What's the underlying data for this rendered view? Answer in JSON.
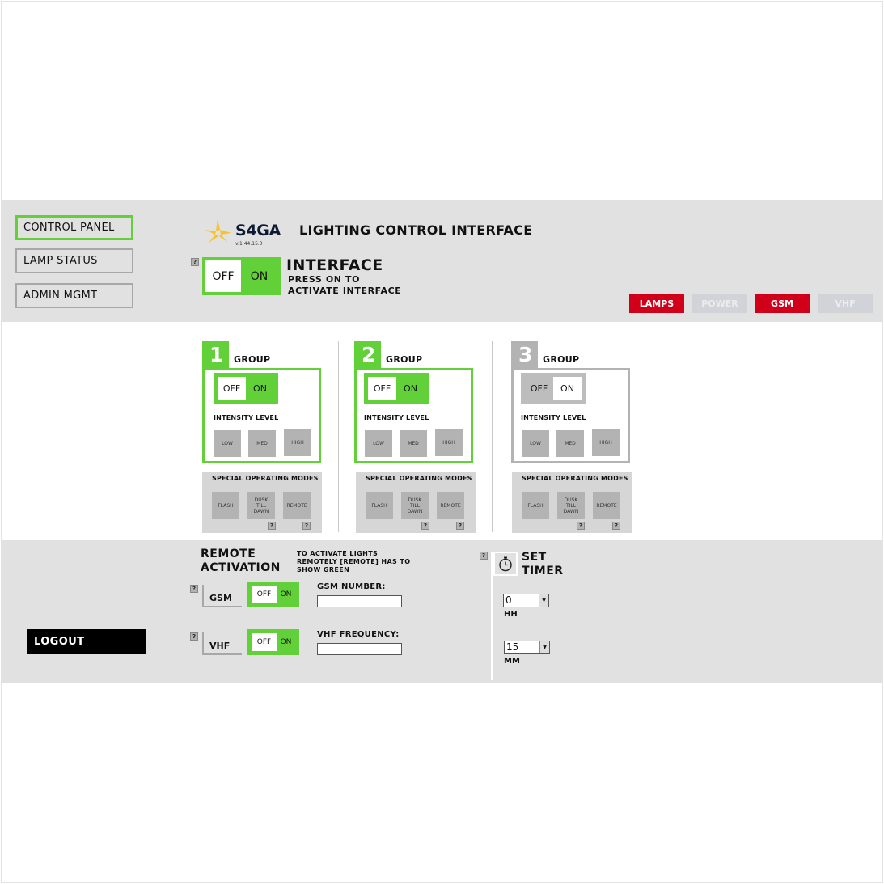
{
  "nav": {
    "items": [
      {
        "label": "CONTROL PANEL",
        "active": true
      },
      {
        "label": "LAMP STATUS",
        "active": false
      },
      {
        "label": "ADMIN MGMT",
        "active": false
      }
    ],
    "logout": "LOGOUT"
  },
  "header": {
    "brand": "S4GA",
    "version": "v.1.44.15.0",
    "title": "LIGHTING CONTROL INTERFACE",
    "interface_title": "INTERFACE",
    "interface_subtitle": "PRESS ON TO ACTIVATE INTERFACE",
    "interface_toggle": {
      "off": "OFF",
      "on": "ON",
      "state": "on"
    },
    "help": "?",
    "status_tags": [
      {
        "label": "LAMPS",
        "state": "alert",
        "color": "#d0001a"
      },
      {
        "label": "POWER",
        "state": "inactive",
        "color": "#d2d2d9"
      },
      {
        "label": "GSM",
        "state": "alert",
        "color": "#d0001a"
      },
      {
        "label": "VHF",
        "state": "inactive",
        "color": "#d2d2d9"
      }
    ]
  },
  "groups": [
    {
      "number": "1",
      "label": "GROUP",
      "active": true,
      "toggle": {
        "off": "OFF",
        "on": "ON"
      },
      "intensity_label": "INTENSITY LEVEL",
      "levels": [
        "LOW",
        "MED",
        "HIGH"
      ],
      "special_title": "SPECIAL OPERATING MODES",
      "modes": [
        "FLASH",
        "DUSK TILL DAWN",
        "REMOTE"
      ]
    },
    {
      "number": "2",
      "label": "GROUP",
      "active": true,
      "toggle": {
        "off": "OFF",
        "on": "ON"
      },
      "intensity_label": "INTENSITY LEVEL",
      "levels": [
        "LOW",
        "MED",
        "HIGH"
      ],
      "special_title": "SPECIAL OPERATING MODES",
      "modes": [
        "FLASH",
        "DUSK TILL DAWN",
        "REMOTE"
      ]
    },
    {
      "number": "3",
      "label": "GROUP",
      "active": false,
      "toggle": {
        "off": "OFF",
        "on": "ON"
      },
      "intensity_label": "INTENSITY LEVEL",
      "levels": [
        "LOW",
        "MED",
        "HIGH"
      ],
      "special_title": "SPECIAL OPERATING MODES",
      "modes": [
        "FLASH",
        "DUSK TILL DAWN",
        "REMOTE"
      ]
    }
  ],
  "remote": {
    "title": "REMOTE ACTIVATION",
    "note": "TO ACTIVATE LIGHTS REMOTELY [REMOTE] HAS TO SHOW GREEN",
    "gsm": {
      "label": "GSM",
      "toggle_off": "OFF",
      "toggle_on": "ON",
      "field_label": "GSM NUMBER:",
      "value": ""
    },
    "vhf": {
      "label": "VHF",
      "toggle_off": "OFF",
      "toggle_on": "ON",
      "field_label": "VHF FREQUENCY:",
      "value": ""
    }
  },
  "timer": {
    "title": "SET TIMER",
    "icon": "stopwatch-icon",
    "hours": {
      "value": "0",
      "label": "HH"
    },
    "minutes": {
      "value": "15",
      "label": "MM"
    }
  },
  "colors": {
    "accent_green": "#62d039",
    "alert_red": "#d0001a",
    "panel_gray": "#e1e1e1",
    "button_gray": "#b3b3b3"
  }
}
